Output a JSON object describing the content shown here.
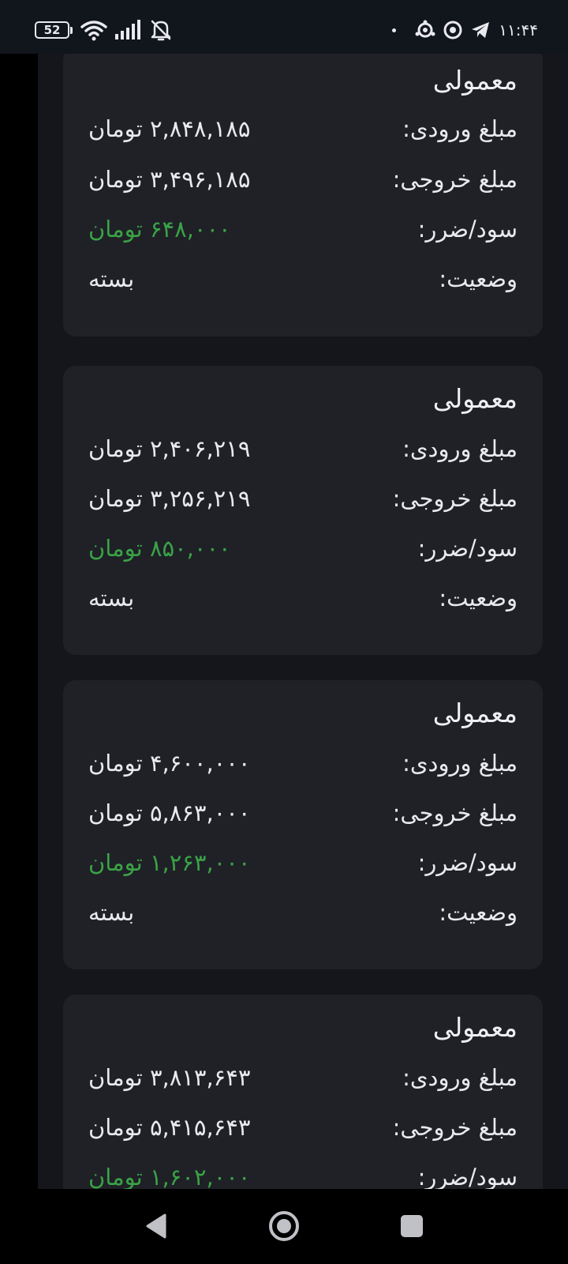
{
  "status_bar": {
    "battery_level": "52",
    "clock": "۱۱:۴۴",
    "icons": [
      "wifi-icon",
      "signal-icon",
      "notifications-off-icon",
      "app-icon",
      "chrome-icon",
      "telegram-icon"
    ]
  },
  "labels": {
    "entry": "مبلغ ورودی:",
    "exit": "مبلغ خروجی:",
    "profit": "سود/ضرر:",
    "status": "وضعیت:"
  },
  "colors": {
    "profit_positive": "#3aa346",
    "card_bg": "#1f2127",
    "page_bg": "#14161c"
  },
  "cards": [
    {
      "title": "معمولی",
      "entry_amount": "۲,۸۴۸,۱۸۵ تومان",
      "exit_amount": "۳,۴۹۶,۱۸۵ تومان",
      "profit": "۶۴۸,۰۰۰ تومان",
      "status": "بسته"
    },
    {
      "title": "معمولی",
      "entry_amount": "۲,۴۰۶,۲۱۹ تومان",
      "exit_amount": "۳,۲۵۶,۲۱۹ تومان",
      "profit": "۸۵۰,۰۰۰ تومان",
      "status": "بسته"
    },
    {
      "title": "معمولی",
      "entry_amount": "۴,۶۰۰,۰۰۰ تومان",
      "exit_amount": "۵,۸۶۳,۰۰۰ تومان",
      "profit": "۱,۲۶۳,۰۰۰ تومان",
      "status": "بسته"
    },
    {
      "title": "معمولی",
      "entry_amount": "۳,۸۱۳,۶۴۳ تومان",
      "exit_amount": "۵,۴۱۵,۶۴۳ تومان",
      "profit": "۱,۶۰۲,۰۰۰ تومان",
      "status": ""
    }
  ],
  "nav": {
    "buttons": [
      "back-button",
      "home-button",
      "recents-button"
    ]
  }
}
